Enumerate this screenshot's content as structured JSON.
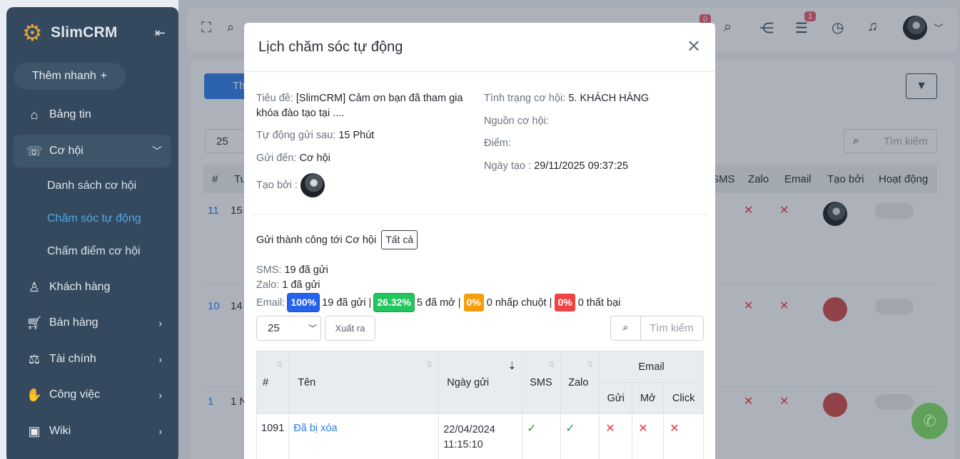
{
  "sidebar": {
    "brand": "SlimCRM",
    "quick_add": "Thêm nhanh",
    "items": [
      {
        "label": "Bảng tin"
      },
      {
        "label": "Cơ hội"
      },
      {
        "label": "Khách hàng"
      },
      {
        "label": "Bán hàng"
      },
      {
        "label": "Tài chính"
      },
      {
        "label": "Công việc"
      },
      {
        "label": "Wiki"
      }
    ],
    "sub_items": [
      {
        "label": "Danh sách cơ hội"
      },
      {
        "label": "Chăm sóc tự động"
      },
      {
        "label": "Chấm điểm cơ hội"
      }
    ]
  },
  "topbar": {
    "badge_a": "0",
    "badge_b": "1"
  },
  "background": {
    "add_button": "Th",
    "page_size": "25",
    "search_placeholder": "Tìm kiếm",
    "headers": [
      "#",
      "Tu",
      "SMS",
      "Zalo",
      "Email",
      "Tạo bởi",
      "Hoạt động"
    ],
    "rows": [
      {
        "id": "11",
        "col2": "15"
      },
      {
        "id": "10",
        "col2": "14"
      },
      {
        "id": "1",
        "col2": "1 N"
      }
    ]
  },
  "modal": {
    "title": "Lịch chăm sóc tự động",
    "title_label": "Tiêu đề:",
    "title_value": "[SlimCRM] Cảm ơn bạn đã tham gia khóa đào tạo tại ....",
    "auto_send_label": "Tự động gửi sau:",
    "auto_send_value": "15 Phút",
    "send_to_label": "Gửi đến:",
    "send_to_value": "Cơ hội",
    "created_by_label": "Tạo bởi :",
    "status_label": "Tình trạng cơ hội:",
    "status_value": "5. KHÁCH HÀNG",
    "source_label": "Nguồn cơ hội:",
    "score_label": "Điểm:",
    "created_date_label": "Ngày tạo :",
    "created_date_value": "29/11/2025 09:37:25",
    "success_text": "Gửi thành công tới Cơ hội",
    "all_button": "Tất cả",
    "sms_label": "SMS:",
    "sms_value": "19 đã gửi",
    "zalo_label": "Zalo:",
    "zalo_value": "1 đã gửi",
    "email_label": "Email:",
    "email_pct_sent": "100%",
    "email_sent": "19 đã gửi",
    "email_pct_open": "26.32%",
    "email_open": "5 đã mở",
    "email_pct_click": "0%",
    "email_click": "0 nhấp chuột",
    "email_pct_fail": "0%",
    "email_fail": "0 thất bại",
    "page_size": "25",
    "export_button": "Xuất ra",
    "search_placeholder": "Tìm kiếm",
    "table": {
      "headers": {
        "num": "#",
        "name": "Tên",
        "date": "Ngày gửi",
        "sms": "SMS",
        "zalo": "Zalo",
        "email": "Email",
        "sent": "Gửi",
        "opened": "Mở",
        "click": "Click"
      },
      "rows": [
        {
          "num": "1091",
          "name": "Đã bị xóa",
          "date": "22/04/2024",
          "time": "11:15:10"
        }
      ]
    }
  },
  "colors": {
    "sidebar": "#34495e",
    "accent": "#4fa9e6",
    "brand_gear": "#e2a33b"
  }
}
